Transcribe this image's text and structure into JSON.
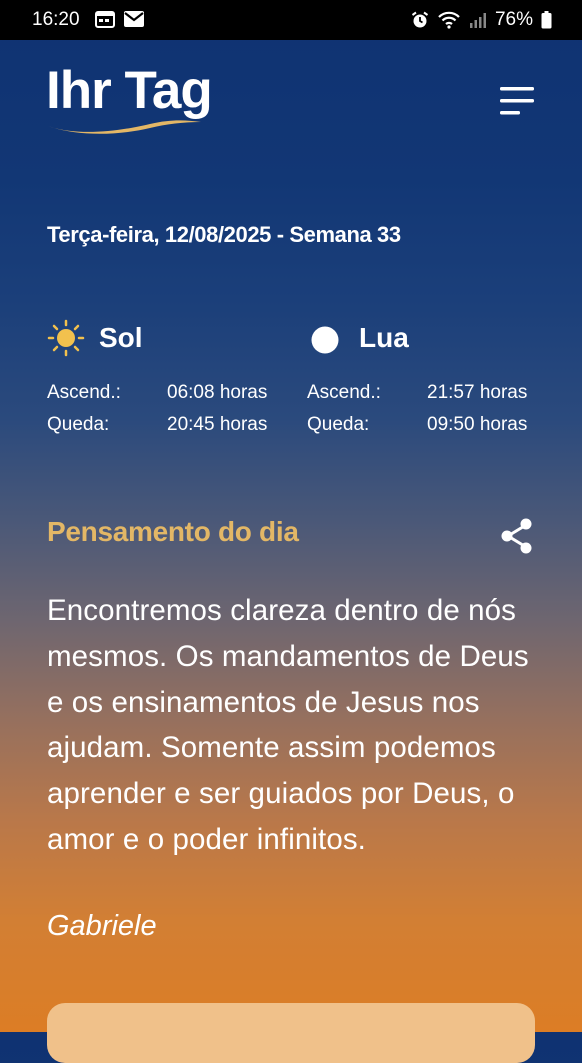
{
  "status_bar": {
    "time": "16:20",
    "battery": "76%"
  },
  "app": {
    "logo": "Ihr Tag"
  },
  "date_line": "Terça-feira, 12/08/2025 - Semana 33",
  "sun": {
    "title": "Sol",
    "rise_label": "Ascend.:",
    "rise_value": "06:08 horas",
    "set_label": "Queda:",
    "set_value": "20:45 horas"
  },
  "moon": {
    "title": "Lua",
    "rise_label": "Ascend.:",
    "rise_value": "21:57 horas",
    "set_label": "Queda:",
    "set_value": "09:50 horas"
  },
  "thought": {
    "title": "Pensamento do dia",
    "text": "Encontremos clareza dentro de nós mesmos. Os mandamentos de Deus e os ensinamentos de Jesus nos ajudam. Somente assim podemos aprender e ser guiados por Deus, o amor e o poder infinitos.",
    "author": "Gabriele"
  },
  "colors": {
    "accent_gold": "#e3b766",
    "header_blue": "#0f3272",
    "sunset_orange": "#dc7d25"
  },
  "icons": [
    "calendar-icon",
    "mail-icon",
    "alarm-icon",
    "wifi-icon",
    "signal-icon",
    "battery-icon",
    "menu-icon",
    "sun-icon",
    "moon-icon",
    "share-icon"
  ]
}
